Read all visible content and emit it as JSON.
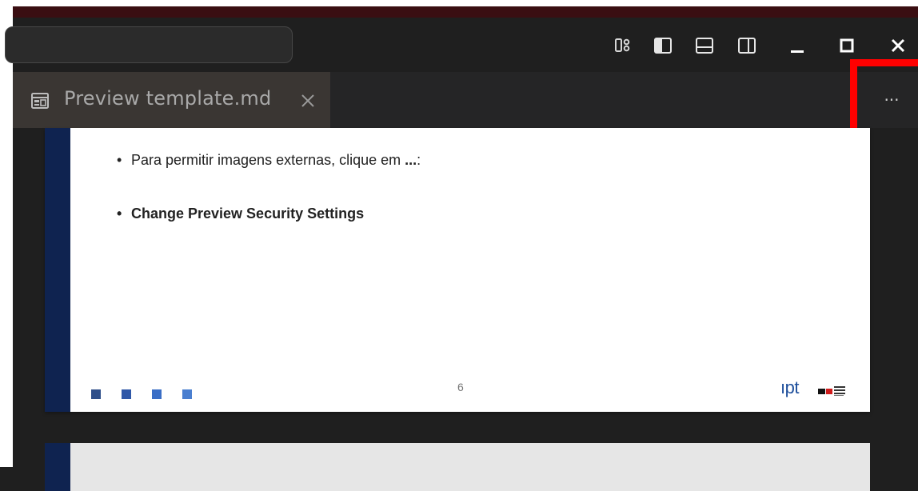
{
  "tab": {
    "label": "Preview template.md"
  },
  "slide": {
    "bullets": [
      {
        "text": "Para permitir imagens externas, clique em ",
        "strong": "...",
        "suffix": ":"
      },
      {
        "text": "Change Preview Security Settings"
      }
    ],
    "page_number": "6",
    "logo_text": "ıpt",
    "square_colors": [
      "#2f4f8a",
      "#2f58a8",
      "#3a6ec6",
      "#4a7fd0"
    ]
  },
  "colors": {
    "accent_bar": "#0f2350",
    "highlight": "#ff0000"
  },
  "icons": {
    "layout": "customize-layout-icon",
    "primary_sidebar": "toggle-primary-sidebar-icon",
    "panel": "toggle-panel-icon",
    "secondary_sidebar": "toggle-secondary-sidebar-icon",
    "minimize": "minimize-icon",
    "maximize": "maximize-icon",
    "close": "close-icon",
    "more": "more-actions-icon"
  },
  "more_actions": "···"
}
